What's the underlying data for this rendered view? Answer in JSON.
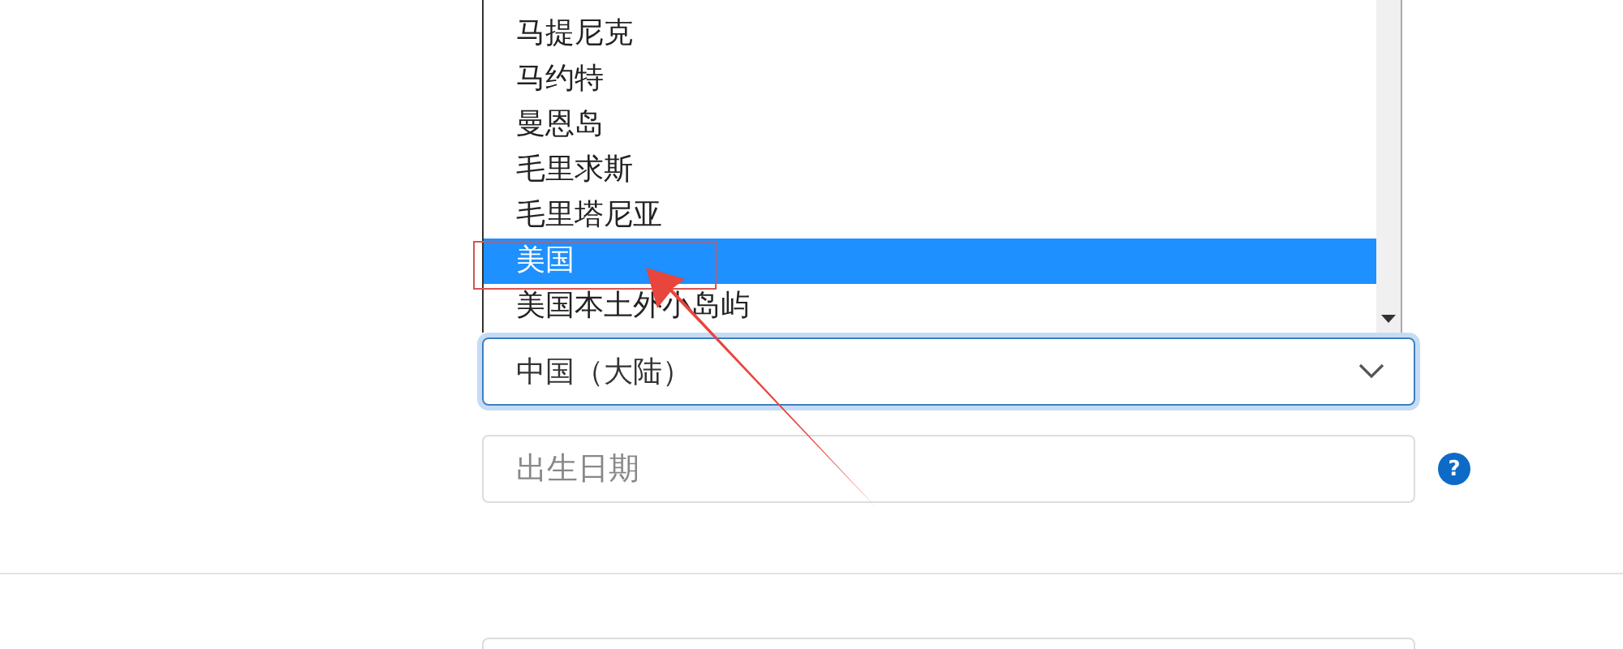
{
  "listbox": {
    "options": [
      {
        "label": "马提尼克",
        "selected": false
      },
      {
        "label": "马约特",
        "selected": false
      },
      {
        "label": "曼恩岛",
        "selected": false
      },
      {
        "label": "毛里求斯",
        "selected": false
      },
      {
        "label": "毛里塔尼亚",
        "selected": false
      },
      {
        "label": "美国",
        "selected": true
      },
      {
        "label": "美国本土外小岛屿",
        "selected": false
      }
    ]
  },
  "country_select": {
    "value": "中国（大陆）"
  },
  "birth_date": {
    "placeholder": "出生日期",
    "help_icon": "?"
  }
}
